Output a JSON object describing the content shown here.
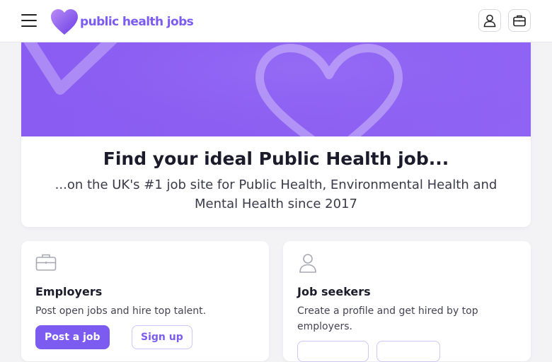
{
  "header": {
    "logo_text": "public health jobs",
    "menu_icon": "hamburger-icon",
    "account_icon": "user-icon",
    "jobs_icon": "briefcase-icon"
  },
  "hero": {
    "title": "Find your ideal Public Health job...",
    "subtitle": "...on the UK's #1 job site for Public Health, Environmental Health and Mental Health since 2017"
  },
  "employers": {
    "icon": "briefcase-icon",
    "heading": "Employers",
    "description": "Post open jobs and hire top talent.",
    "primary_button": "Post a job",
    "secondary_button": "Sign up"
  },
  "jobseekers": {
    "icon": "user-icon",
    "heading": "Job seekers",
    "description": "Create a profile and get hired by top employers."
  },
  "colors": {
    "brand": "#7c5cf0",
    "banner": "#8a5cf2",
    "background": "#f3f3f6"
  }
}
